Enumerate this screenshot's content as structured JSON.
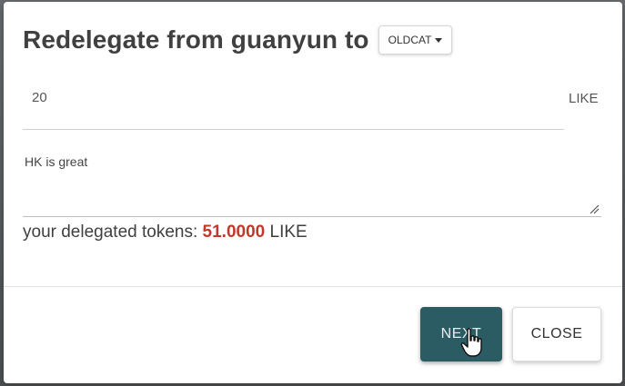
{
  "dialog": {
    "title": "Redelegate from guanyun to",
    "validator_dropdown": {
      "selected": "OLDCAT"
    }
  },
  "amount_field": {
    "value": "20",
    "unit": "LIKE"
  },
  "memo_field": {
    "value": "HK is great"
  },
  "delegated": {
    "label": "your delegated tokens:",
    "amount": "51.0000",
    "unit": "LIKE",
    "amount_color": "#c0392b"
  },
  "actions": {
    "next_label": "NEXT",
    "close_label": "CLOSE",
    "next_color": "#2c5c63"
  },
  "cursor": {
    "icon": "hand-pointer-icon"
  }
}
